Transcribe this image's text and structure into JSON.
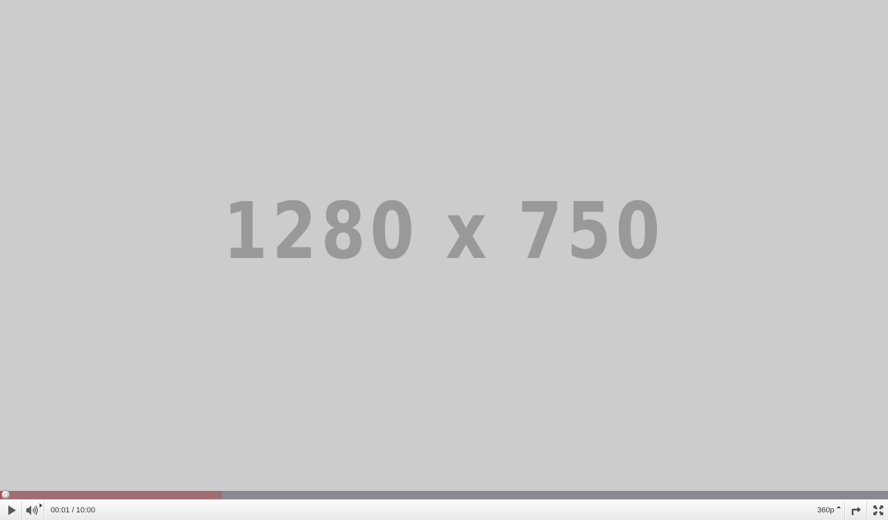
{
  "video": {
    "placeholder": "1280 x 750"
  },
  "progress": {
    "played_fraction": 0.0017,
    "loaded_fraction": 0.25
  },
  "controls": {
    "play_icon": "play-icon",
    "volume_icon": "volume-icon",
    "current_time": "00:01",
    "time_separator": " / ",
    "duration": "10:00",
    "quality": "360p",
    "popout_icon": "popout-icon",
    "fullscreen_icon": "fullscreen-icon"
  },
  "colors": {
    "background": "#cccccc",
    "placeholder_text": "#999999",
    "progress_track": "#888890",
    "progress_loaded": "#a06e72",
    "controls_bg": "#f2f2f2"
  }
}
